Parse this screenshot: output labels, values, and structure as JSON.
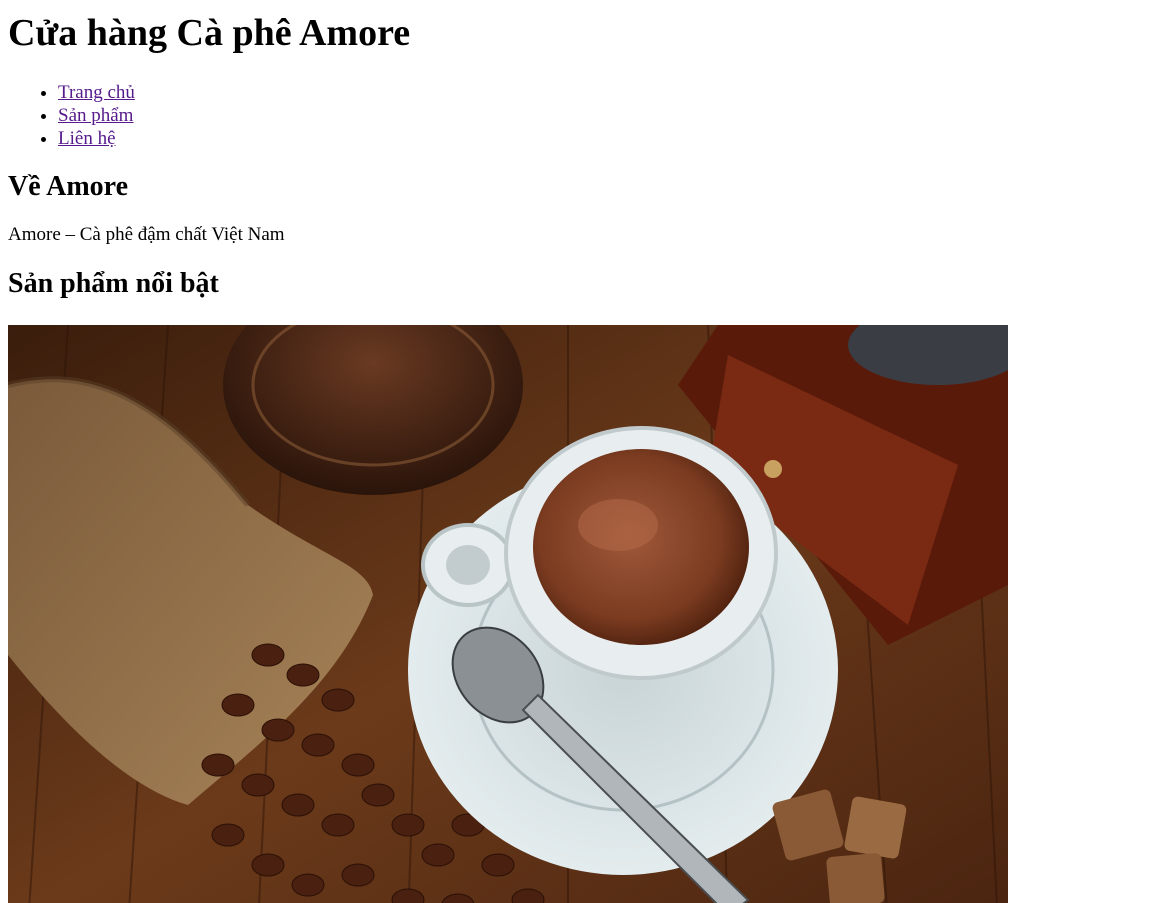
{
  "header": {
    "title": "Cửa hàng Cà phê Amore"
  },
  "nav": {
    "items": [
      {
        "label": "Trang chủ"
      },
      {
        "label": "Sản phẩm"
      },
      {
        "label": "Liên hệ"
      }
    ]
  },
  "about": {
    "heading": "Về Amore",
    "tagline": "Amore – Cà phê đậm chất Việt Nam"
  },
  "featured": {
    "heading": "Sản phẩm nổi bật",
    "image_subject": "coffee-cup-beans-photo"
  },
  "colors": {
    "link": "#551a8b",
    "text": "#000000",
    "background": "#ffffff"
  }
}
